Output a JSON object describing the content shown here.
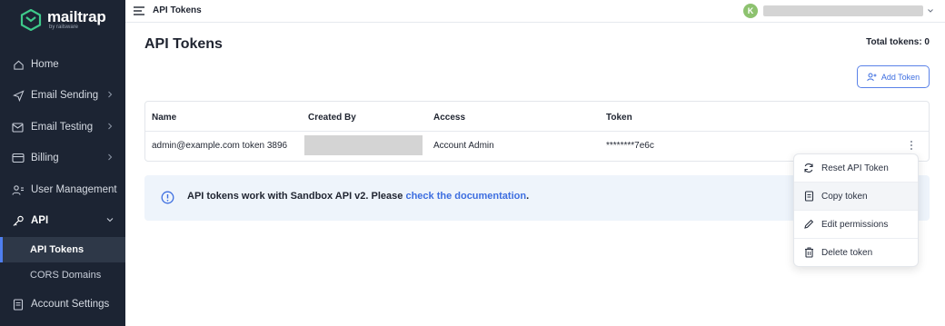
{
  "sidebar": {
    "logo_title": "mailtrap",
    "logo_sub": "by railsware",
    "items": [
      {
        "label": "Home"
      },
      {
        "label": "Email Sending"
      },
      {
        "label": "Email Testing"
      },
      {
        "label": "Billing"
      },
      {
        "label": "User Management"
      },
      {
        "label": "API"
      },
      {
        "label": "API Tokens"
      },
      {
        "label": "CORS Domains"
      },
      {
        "label": "Account Settings"
      }
    ]
  },
  "topbar": {
    "breadcrumb": "API Tokens",
    "avatar_initial": "K"
  },
  "main": {
    "title": "API Tokens",
    "total_tokens": "Total tokens: 0",
    "add_button": "Add Token",
    "table": {
      "headers": [
        "Name",
        "Created By",
        "Access",
        "Token"
      ],
      "rows": [
        {
          "name": "admin@example.com token 3896",
          "access": "Account Admin",
          "token": "********7e6c"
        }
      ]
    },
    "info": {
      "text": "API tokens work with Sandbox API v2. Please ",
      "link": "check the documentation",
      "suffix": "."
    }
  },
  "menu": {
    "items": [
      {
        "label": "Reset API Token",
        "icon": "refresh-icon"
      },
      {
        "label": "Copy token",
        "icon": "document-icon"
      },
      {
        "label": "Edit permissions",
        "icon": "pencil-icon"
      },
      {
        "label": "Delete token",
        "icon": "trash-icon"
      }
    ]
  },
  "colors": {
    "sidebar_bg": "#1c2433",
    "accent": "#3d6ee0",
    "brand_green": "#8dc26f",
    "info_bg": "#eef4fb"
  }
}
